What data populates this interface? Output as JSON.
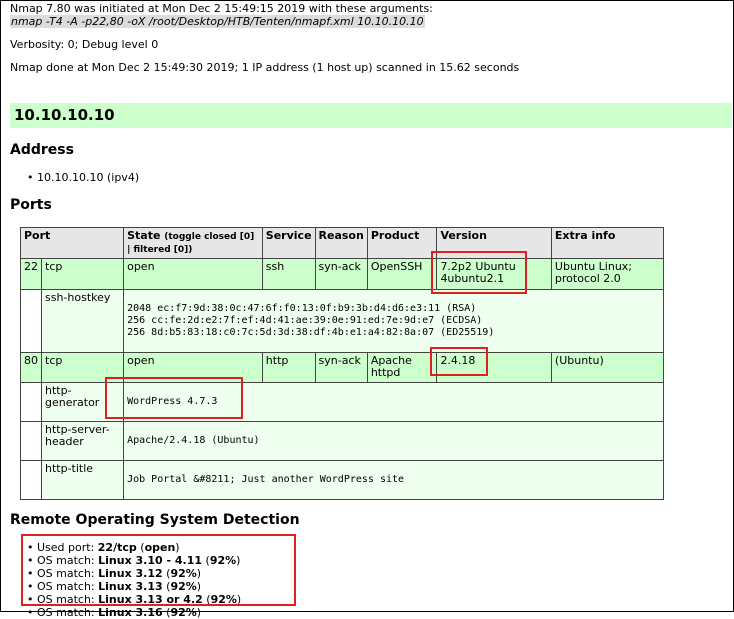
{
  "intro": {
    "initiated": "Nmap 7.80 was initiated at Mon Dec 2 15:49:15 2019 with these arguments:",
    "command": "nmap -T4 -A -p22,80 -oX /root/Desktop/HTB/Tenten/nmapf.xml 10.10.10.10",
    "verbosity": "Verbosity: 0; Debug level 0",
    "done": "Nmap done at Mon Dec 2 15:49:30 2019; 1 IP address (1 host up) scanned in 15.62 seconds"
  },
  "host": "10.10.10.10",
  "address": {
    "heading": "Address",
    "items": [
      "10.10.10.10 (ipv4)"
    ]
  },
  "ports": {
    "heading": "Ports",
    "headers": {
      "port": "Port",
      "state": "State",
      "toggle": "(toggle closed [0] | filtered [0])",
      "service": "Service",
      "reason": "Reason",
      "product": "Product",
      "version": "Version",
      "extra": "Extra info"
    },
    "rows": [
      {
        "port": "22",
        "proto": "tcp",
        "state": "open",
        "service": "ssh",
        "reason": "syn-ack",
        "product": "OpenSSH",
        "version": "7.2p2 Ubuntu 4ubuntu2.1",
        "extra": "Ubuntu Linux; protocol 2.0"
      },
      {
        "port": "80",
        "proto": "tcp",
        "state": "open",
        "service": "http",
        "reason": "syn-ack",
        "product": "Apache httpd",
        "version": "2.4.18",
        "extra": "(Ubuntu)"
      }
    ],
    "scripts": {
      "ssh_hostkey": {
        "name": "ssh-hostkey",
        "output": "2048 ec:f7:9d:38:0c:47:6f:f0:13:0f:b9:3b:d4:d6:e3:11 (RSA)\n256 cc:fe:2d:e2:7f:ef:4d:41:ae:39:0e:91:ed:7e:9d:e7 (ECDSA)\n256 8d:b5:83:18:c0:7c:5d:3d:38:df:4b:e1:a4:82:8a:07 (ED25519)"
      },
      "http_generator": {
        "name": "http-generator",
        "output": "WordPress 4.7.3"
      },
      "http_server_header": {
        "name": "http-server-header",
        "output": "Apache/2.4.18 (Ubuntu)"
      },
      "http_title": {
        "name": "http-title",
        "output": "Job Portal &#8211; Just another WordPress site"
      }
    }
  },
  "os": {
    "heading": "Remote Operating System Detection",
    "used_port": {
      "label": "Used port: ",
      "value": "22/tcp",
      "state": "open"
    },
    "matches": [
      {
        "label": "OS match: ",
        "name": "Linux 3.10 - 4.11",
        "accuracy": "92%"
      },
      {
        "label": "OS match: ",
        "name": "Linux 3.12",
        "accuracy": "92%"
      },
      {
        "label": "OS match: ",
        "name": "Linux 3.13",
        "accuracy": "92%"
      },
      {
        "label": "OS match: ",
        "name": "Linux 3.13 or 4.2",
        "accuracy": "92%"
      },
      {
        "label": "OS match: ",
        "name": "Linux 3.16",
        "accuracy": "92%"
      }
    ]
  },
  "colors": {
    "open_row": "#ccffcc",
    "script_row": "#efffef",
    "highlight": "#e02020",
    "host_bar": "#ccffcc"
  }
}
